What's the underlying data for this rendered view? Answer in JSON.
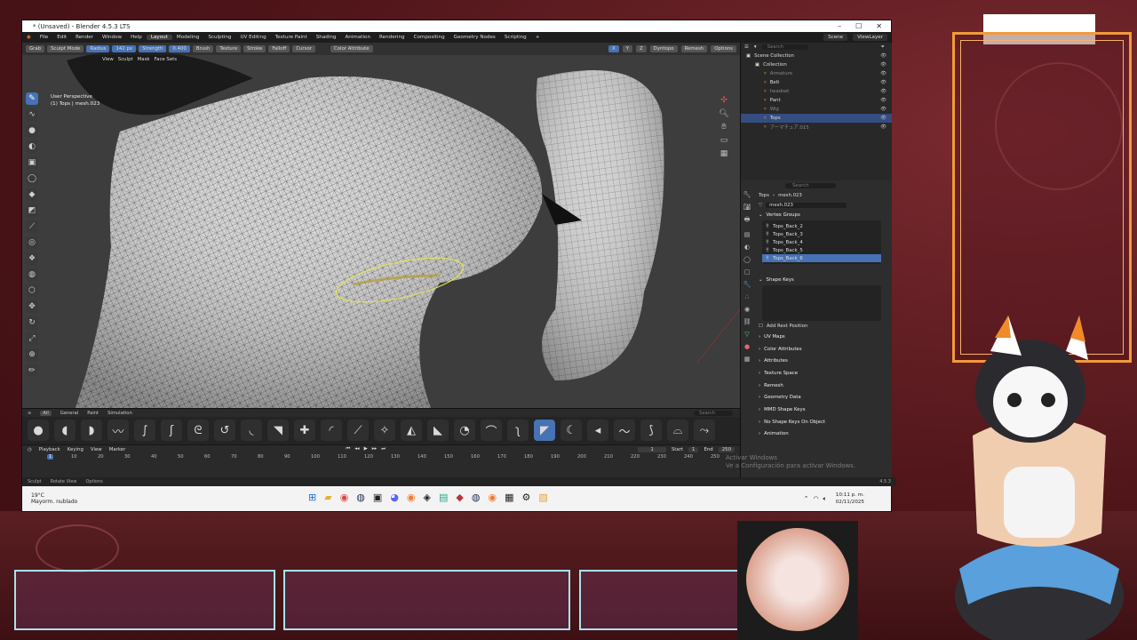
{
  "window": {
    "title": "* (Unsaved) - Blender 4.5.3 LTS"
  },
  "menubar": {
    "menus": [
      "File",
      "Edit",
      "Render",
      "Window",
      "Help"
    ],
    "workspaces": [
      "Layout",
      "Modeling",
      "Sculpting",
      "UV Editing",
      "Texture Paint",
      "Shading",
      "Animation",
      "Rendering",
      "Compositing",
      "Geometry Nodes",
      "Scripting"
    ],
    "active_workspace": "Layout",
    "add_tab": "+",
    "scene": "Scene",
    "view_layer": "ViewLayer"
  },
  "tool_header": {
    "tool": "Grab",
    "radius_label": "Radius",
    "radius_value": "142 px",
    "strength_label": "Strength",
    "strength_value": "0.400",
    "brush": "Brush",
    "texture": "Texture",
    "stroke": "Stroke",
    "falloff": "Falloff",
    "cursor": "Cursor",
    "color_attribute": "Color Attribute",
    "axes": [
      "X",
      "Y",
      "Z"
    ],
    "dyntopo": "Dyntopo",
    "remesh": "Remesh",
    "options": "Options"
  },
  "mode_header": {
    "mode": "Sculpt Mode",
    "items": [
      "View",
      "Sculpt",
      "Mask",
      "Face Sets"
    ]
  },
  "viewport": {
    "perspective": "User Perspective",
    "object": "(1) Tops | mesh.023"
  },
  "asset_shelf": {
    "tabs": [
      "All",
      "General",
      "Paint",
      "Simulation"
    ],
    "active_tab": "All",
    "search_placeholder": "Search"
  },
  "timeline": {
    "menus": [
      "Playback",
      "Keying",
      "View",
      "Marker"
    ],
    "current_frame": "1",
    "start_label": "Start",
    "start": "1",
    "end_label": "End",
    "end": "250",
    "ticks": [
      "1",
      "10",
      "20",
      "30",
      "40",
      "50",
      "60",
      "70",
      "80",
      "90",
      "100",
      "110",
      "120",
      "130",
      "140",
      "150",
      "160",
      "170",
      "180",
      "190",
      "200",
      "210",
      "220",
      "230",
      "240",
      "250"
    ]
  },
  "statusbar": {
    "items": [
      "Sculpt",
      "Rotate View",
      "Options"
    ],
    "version": "4.5.3"
  },
  "outliner": {
    "search_placeholder": "Search",
    "rows": [
      {
        "name": "Scene Collection",
        "depth": 0,
        "dim": false,
        "selected": false
      },
      {
        "name": "Collection",
        "depth": 1,
        "dim": false,
        "selected": false
      },
      {
        "name": "Armature",
        "depth": 2,
        "dim": true,
        "selected": false
      },
      {
        "name": "Belt",
        "depth": 2,
        "dim": false,
        "selected": false
      },
      {
        "name": "headset",
        "depth": 2,
        "dim": true,
        "selected": false
      },
      {
        "name": "Pant",
        "depth": 2,
        "dim": false,
        "selected": false
      },
      {
        "name": "Wig",
        "depth": 2,
        "dim": true,
        "selected": false
      },
      {
        "name": "Tops",
        "depth": 2,
        "dim": false,
        "selected": true
      },
      {
        "name": "アーマチュア.015",
        "depth": 2,
        "dim": true,
        "selected": false
      }
    ]
  },
  "properties": {
    "search_placeholder": "Search",
    "breadcrumb_object": "Tops",
    "breadcrumb_mesh": "mesh.023",
    "mesh_name": "mesh.023",
    "vertex_groups_title": "Vertex Groups",
    "vertex_groups": [
      "Tops_Back_2",
      "Tops_Back_3",
      "Tops_Back_4",
      "Tops_Back_5",
      "Tops_Back_6"
    ],
    "selected_vertex_group": "Tops_Back_6",
    "shape_keys_title": "Shape Keys",
    "add_rest_position": "Add Rest Position",
    "panels": [
      "UV Maps",
      "Color Attributes",
      "Attributes",
      "Texture Space",
      "Remesh",
      "Geometry Data",
      "MMD Shape Keys",
      "No Shape Keys On Object",
      "Animation"
    ]
  },
  "watermark": {
    "line1": "Activar Windows",
    "line2": "Ve a Configuración para activar Windows."
  },
  "taskbar": {
    "temperature": "19°C",
    "weather": "Mayorm. nublado",
    "time": "10:11 p. m.",
    "date": "02/11/2025"
  }
}
